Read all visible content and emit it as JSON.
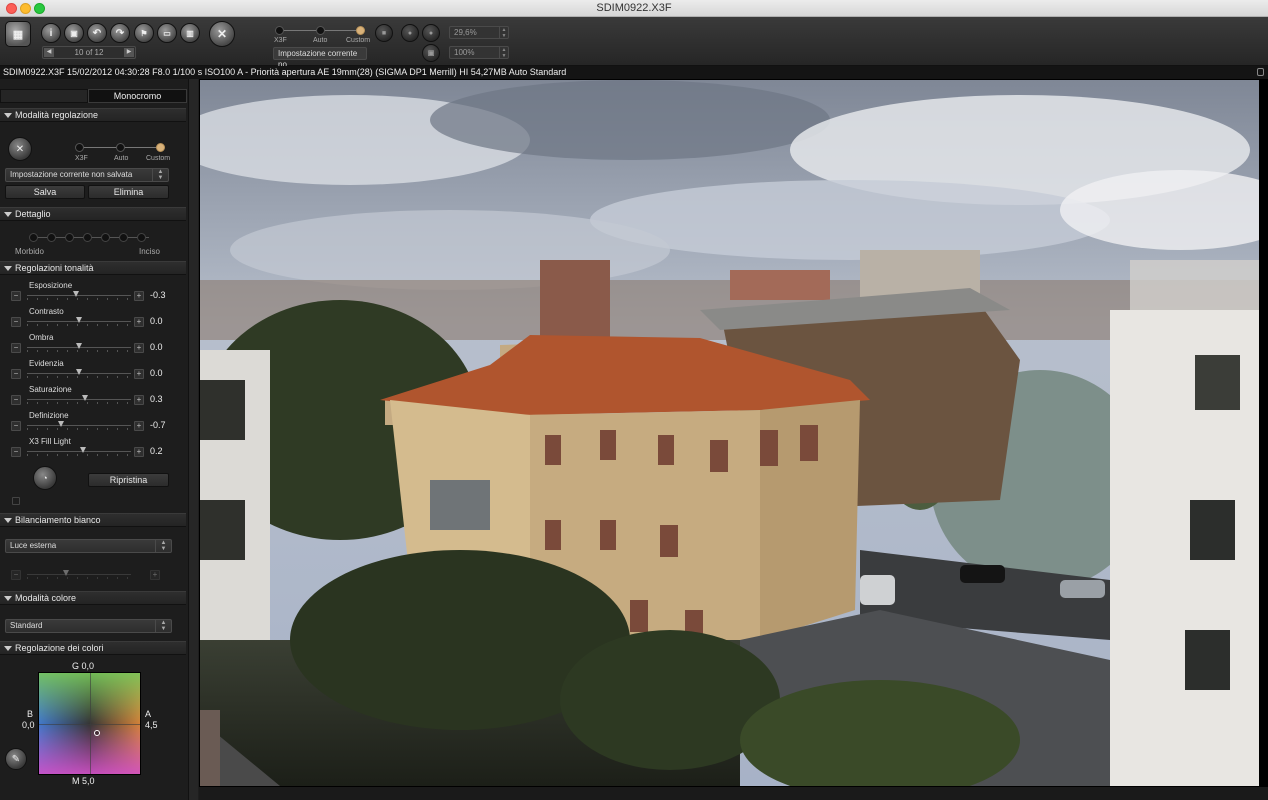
{
  "window": {
    "title": "SDIM0922.X3F"
  },
  "toolbar": {
    "counter": "10 of 12",
    "mode_labels": [
      "X3F",
      "Auto",
      "Custom"
    ],
    "preset_label": "Impostazione corrente no",
    "zoom_percent": "29,6%",
    "zoom_full": "100%",
    "icons": [
      "grid-icon",
      "info-icon",
      "save-icon",
      "rotate-left-icon",
      "rotate-right-icon",
      "flag-icon",
      "lock-icon",
      "trash-icon",
      "sigma-logo-icon"
    ]
  },
  "infobar": {
    "text": "SDIM0922.X3F 15/02/2012 04:30:28 F8.0 1/100 s ISO100 A - Priorità apertura AE 19mm(28) (SIGMA DP1 Merrill) HI 54,27MB Auto Standard"
  },
  "sidebar": {
    "tab_label": "Monocromo",
    "sections": {
      "modalita_regolazione": "Modalità regolazione",
      "dettaglio": "Dettaglio",
      "regolazioni_tonalita": "Regolazioni tonalità",
      "bilanciamento_bianco": "Bilanciamento bianco",
      "modalita_colore": "Modalità colore",
      "regolazione_colori": "Regolazione dei colori"
    },
    "mode_labels": [
      "X3F",
      "Auto",
      "Custom"
    ],
    "preset_select": "Impostazione corrente non salvata",
    "save_label": "Salva",
    "delete_label": "Elimina",
    "detail_left": "Morbido",
    "detail_right": "Inciso",
    "adjustments": [
      {
        "name": "Esposizione",
        "value": "-0.3",
        "pos": 0.47
      },
      {
        "name": "Contrasto",
        "value": "0.0",
        "pos": 0.5
      },
      {
        "name": "Ombra",
        "value": "0.0",
        "pos": 0.5
      },
      {
        "name": "Evidenzia",
        "value": "0.0",
        "pos": 0.5
      },
      {
        "name": "Saturazione",
        "value": "0.3",
        "pos": 0.56
      },
      {
        "name": "Definizione",
        "value": "-0.7",
        "pos": 0.33
      },
      {
        "name": "X3 Fill Light",
        "value": "0.2",
        "pos": 0.54
      }
    ],
    "reset_label": "Ripristina",
    "wb_select": "Luce esterna",
    "color_mode_select": "Standard",
    "color_grid": {
      "top_label": "G",
      "top_value": "0,0",
      "left_label": "B",
      "left_value": "0,0",
      "right_label": "A",
      "right_value": "4,5",
      "bottom_label": "M",
      "bottom_value": "5,0"
    }
  }
}
